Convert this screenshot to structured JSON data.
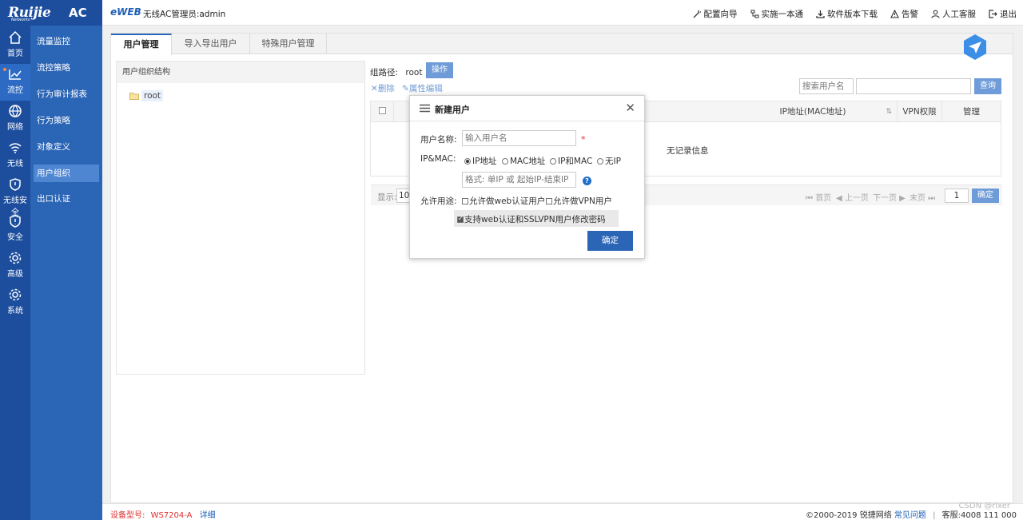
{
  "brand": {
    "logo": "Ruijie",
    "logo_sub": "Networks",
    "product": "AC",
    "eweb": "eWEB"
  },
  "header": {
    "admin_text": "无线AC管理员:admin",
    "links": [
      {
        "icon": "wand-icon",
        "label": "配置向导"
      },
      {
        "icon": "network-icon",
        "label": "实施一本通"
      },
      {
        "icon": "download-icon",
        "label": "软件版本下载"
      },
      {
        "icon": "alert-icon",
        "label": "告警"
      },
      {
        "icon": "user-icon",
        "label": "人工客服"
      },
      {
        "icon": "logout-icon",
        "label": "退出"
      }
    ]
  },
  "rail": [
    {
      "label": "首页",
      "icon": "home-icon"
    },
    {
      "label": "流控",
      "icon": "chart-icon",
      "active": true
    },
    {
      "label": "网络",
      "icon": "globe-icon"
    },
    {
      "label": "无线",
      "icon": "wifi-icon"
    },
    {
      "label": "无线安全",
      "icon": "shield-icon"
    },
    {
      "label": "安全",
      "icon": "shield-alert-icon"
    },
    {
      "label": "高级",
      "icon": "gear-icon"
    },
    {
      "label": "系统",
      "icon": "gear-icon"
    }
  ],
  "submenu": [
    {
      "label": "流量监控"
    },
    {
      "label": "流控策略"
    },
    {
      "label": "行为审计报表"
    },
    {
      "label": "行为策略"
    },
    {
      "label": "对象定义"
    },
    {
      "label": "用户组织",
      "active": true
    },
    {
      "label": "出口认证"
    }
  ],
  "tabs": [
    {
      "label": "用户管理",
      "active": true
    },
    {
      "label": "导入导出用户"
    },
    {
      "label": "特殊用户管理"
    }
  ],
  "tree": {
    "title": "用户组织结构",
    "root": "root"
  },
  "toolbar": {
    "group_path_label": "组路径:",
    "group_path_value": "root",
    "op_button": "操作",
    "delete": "删除",
    "edit": "属性编辑",
    "search_select": "搜索用户名",
    "search_button": "查询"
  },
  "grid": {
    "columns": [
      "IP地址(MAC地址)",
      "VPN权限",
      "管理"
    ],
    "empty": "无记录信息",
    "show_label": "显示:",
    "page_size": "10",
    "pager": [
      "首页",
      "上一页",
      "下一页",
      "末页"
    ],
    "page": "1",
    "go": "确定"
  },
  "modal": {
    "title": "新建用户",
    "username_label": "用户名称:",
    "username_placeholder": "输入用户名",
    "required": "*",
    "ipmac_label": "IP&MAC:",
    "radios": [
      {
        "label": "IP地址",
        "checked": true
      },
      {
        "label": "MAC地址"
      },
      {
        "label": "IP和MAC"
      },
      {
        "label": "无IP"
      }
    ],
    "format_placeholder": "格式: 单IP 或 起始IP-结束IP",
    "help": "?",
    "usage_label": "允许用途:",
    "usage_options": [
      {
        "label": "允许做web认证用户",
        "checked": false
      },
      {
        "label": "允许做VPN用户",
        "checked": false
      }
    ],
    "ssl_option": {
      "label": "支持web认证和SSLVPN用户修改密码",
      "checked": true
    },
    "ok": "确定"
  },
  "footer": {
    "model_label": "设备型号:",
    "model": "WS7204-A",
    "detail": "详细",
    "copyright": "©2000-2019 锐捷网络",
    "faq": "常见问题",
    "support": "客服:4008 111 000"
  },
  "watermark": "CSDN @rixer",
  "colors": {
    "rail": "#1d4e9e",
    "submenu": "#2b65b6",
    "primary": "#2b65b6",
    "accent_btn": "#6f9cd8"
  }
}
